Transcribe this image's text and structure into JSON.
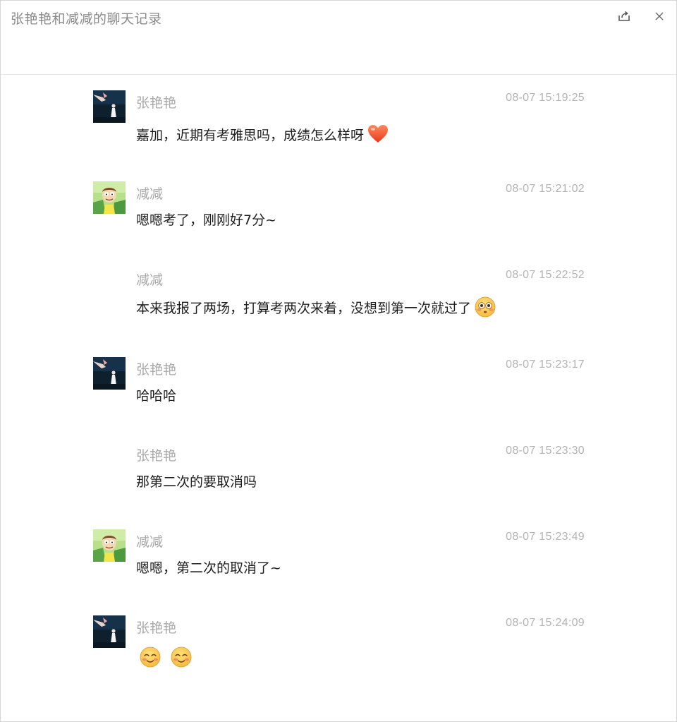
{
  "window": {
    "title": "张艳艳和减减的聊天记录",
    "share_icon": "share-icon",
    "close_icon": "close-icon"
  },
  "messages": [
    {
      "sender": "张艳艳",
      "time": "08-07 15:19:25",
      "text": "嘉加，近期有考雅思吗，成绩怎么样呀",
      "emojis": [
        "heart-emoji"
      ],
      "avatar": "zhangyanyan-avatar"
    },
    {
      "sender": "减减",
      "time": "08-07 15:21:02",
      "text": "嗯嗯考了，刚刚好7分~",
      "emojis": [],
      "avatar": "jianjian-avatar"
    },
    {
      "sender": "减减",
      "time": "08-07 15:22:52",
      "text": "本来我报了两场，打算考两次来着，没想到第一次就过了",
      "emojis": [
        "flushed-emoji"
      ],
      "avatar": ""
    },
    {
      "sender": "张艳艳",
      "time": "08-07 15:23:17",
      "text": "哈哈哈",
      "emojis": [],
      "avatar": "zhangyanyan-avatar"
    },
    {
      "sender": "张艳艳",
      "time": "08-07 15:23:30",
      "text": "那第二次的要取消吗",
      "emojis": [],
      "avatar": ""
    },
    {
      "sender": "减减",
      "time": "08-07 15:23:49",
      "text": "嗯嗯，第二次的取消了~",
      "emojis": [],
      "avatar": "jianjian-avatar"
    },
    {
      "sender": "张艳艳",
      "time": "08-07 15:24:09",
      "text": "",
      "emojis": [
        "blush-emoji",
        "blush-emoji"
      ],
      "avatar": "zhangyanyan-avatar"
    }
  ],
  "colors": {
    "sender": "#a9a9a9",
    "time": "#b3b3b3",
    "text": "#1e1e1e",
    "title": "#8a8a8a"
  }
}
